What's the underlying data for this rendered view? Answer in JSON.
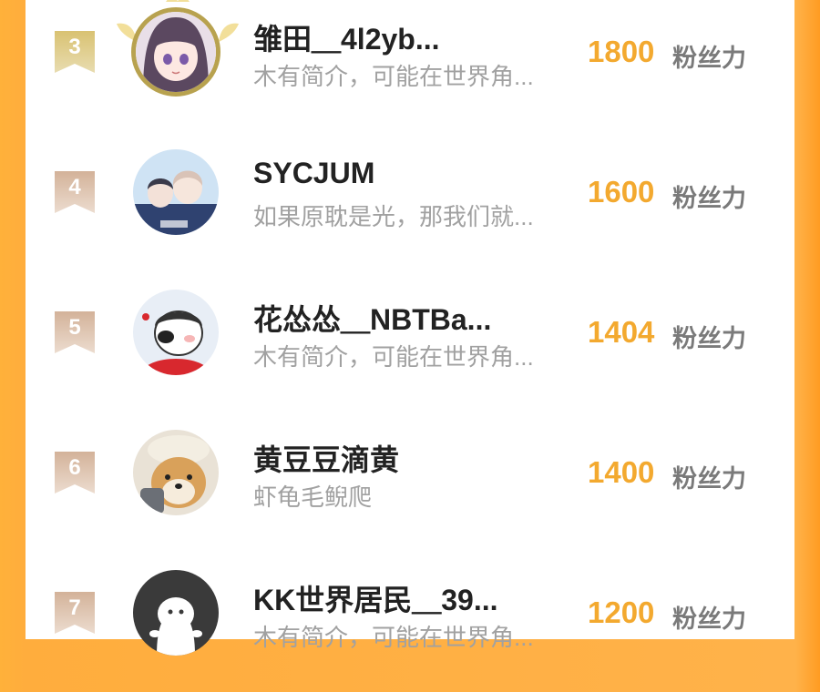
{
  "rankings": [
    {
      "rank": "3",
      "name": "雏田＿4l2yb...",
      "bio": "木有简介，可能在世界角...",
      "score": "1800",
      "unit": "粉丝力",
      "avatar": "anime-girl-avatar"
    },
    {
      "rank": "4",
      "name": "SYCJUM",
      "bio": "如果原耽是光，那我们就...",
      "score": "1600",
      "unit": "粉丝力",
      "avatar": "anime-boys-avatar"
    },
    {
      "rank": "5",
      "name": "花怂怂＿NBTBa...",
      "bio": "木有简介，可能在世界角...",
      "score": "1404",
      "unit": "粉丝力",
      "avatar": "cartoon-boy-avatar"
    },
    {
      "rank": "6",
      "name": "黄豆豆滴黄",
      "bio": "虾龟毛鲵爬",
      "score": "1400",
      "unit": "粉丝力",
      "avatar": "shiba-dog-avatar"
    },
    {
      "rank": "7",
      "name": "KK世界居民＿39...",
      "bio": "木有简介，可能在世界角...",
      "score": "1200",
      "unit": "粉丝力",
      "avatar": "default-ghost-avatar"
    }
  ],
  "colors": {
    "score": "#f3a92f",
    "rank3_badge": "#c9b15f",
    "rank_badge": "#d7b79a",
    "background": "#ffb13a"
  }
}
